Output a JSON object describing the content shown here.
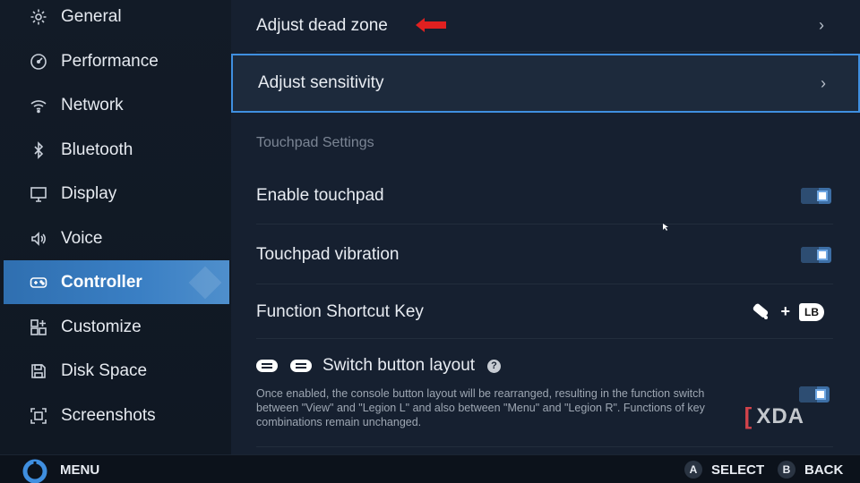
{
  "sidebar": {
    "items": [
      {
        "label": "General",
        "icon": "gear-icon"
      },
      {
        "label": "Performance",
        "icon": "gauge-icon"
      },
      {
        "label": "Network",
        "icon": "wifi-icon"
      },
      {
        "label": "Bluetooth",
        "icon": "bluetooth-icon"
      },
      {
        "label": "Display",
        "icon": "monitor-icon"
      },
      {
        "label": "Voice",
        "icon": "speaker-icon"
      },
      {
        "label": "Controller",
        "icon": "gamepad-icon",
        "active": true
      },
      {
        "label": "Customize",
        "icon": "grid-plus-icon"
      },
      {
        "label": "Disk Space",
        "icon": "disk-icon"
      },
      {
        "label": "Screenshots",
        "icon": "screenshot-icon"
      }
    ]
  },
  "main": {
    "dead_zone_label": "Adjust dead zone",
    "sensitivity_label": "Adjust sensitivity",
    "touchpad_section": "Touchpad Settings",
    "enable_touchpad_label": "Enable touchpad",
    "enable_touchpad_on": true,
    "touchpad_vibration_label": "Touchpad vibration",
    "touchpad_vibration_on": true,
    "shortcut_label": "Function Shortcut Key",
    "shortcut_plus": "+",
    "shortcut_key": "LB",
    "switch_layout_label": "Switch button layout",
    "switch_help": "?",
    "switch_desc": "Once enabled, the console button layout will be rearranged, resulting in the function switch between \"View\" and \"Legion L\" and also between \"Menu\" and \"Legion R\". Functions of key combinations remain unchanged.",
    "switch_layout_on": true,
    "chevron": "›"
  },
  "watermark": {
    "text": "XDA",
    "bracket": "["
  },
  "bottom": {
    "menu_label": "MENU",
    "select_key": "A",
    "select_label": "SELECT",
    "back_key": "B",
    "back_label": "BACK"
  },
  "colors": {
    "accent": "#3f8fe0",
    "active_item": "#3a7fc4",
    "annotation_arrow": "#e02020"
  }
}
